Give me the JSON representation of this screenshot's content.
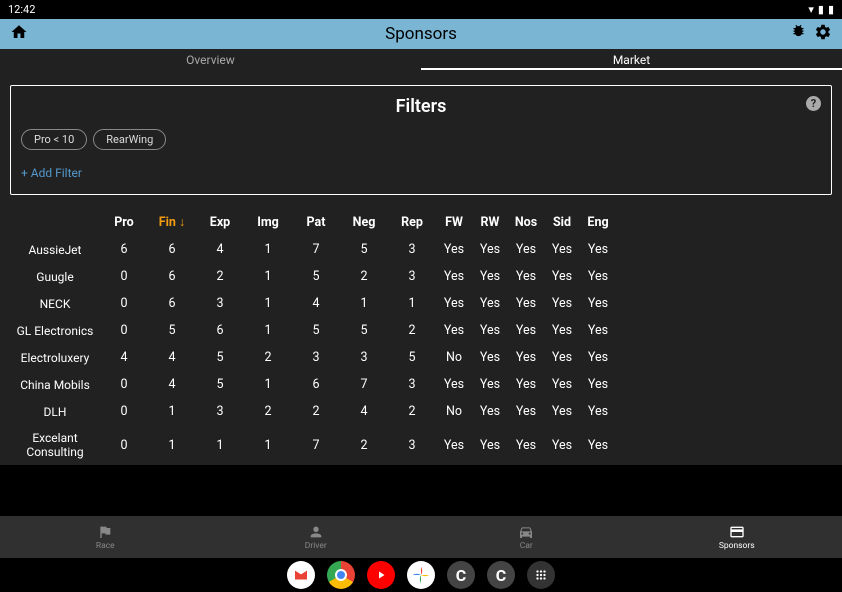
{
  "status": {
    "time": "12:42"
  },
  "header": {
    "title": "Sponsors"
  },
  "tabs": {
    "overview": "Overview",
    "market": "Market"
  },
  "filters": {
    "title": "Filters",
    "chips": [
      "Pro < 10",
      "RearWing"
    ],
    "add": "+ Add Filter"
  },
  "columns": [
    "Pro",
    "Fin",
    "Exp",
    "Img",
    "Pat",
    "Neg",
    "Rep",
    "FW",
    "RW",
    "Nos",
    "Sid",
    "Eng"
  ],
  "sort_col": "Fin",
  "rows": [
    {
      "name": "AussieJet",
      "nums": [
        6,
        6,
        4,
        1,
        7,
        5,
        3
      ],
      "bools": [
        "Yes",
        "Yes",
        "Yes",
        "Yes",
        "Yes"
      ]
    },
    {
      "name": "Guugle",
      "nums": [
        0,
        6,
        2,
        1,
        5,
        2,
        3
      ],
      "bools": [
        "Yes",
        "Yes",
        "Yes",
        "Yes",
        "Yes"
      ]
    },
    {
      "name": "NECK",
      "nums": [
        0,
        6,
        3,
        1,
        4,
        1,
        1
      ],
      "bools": [
        "Yes",
        "Yes",
        "Yes",
        "Yes",
        "Yes"
      ]
    },
    {
      "name": "GL Electronics",
      "nums": [
        0,
        5,
        6,
        1,
        5,
        5,
        2
      ],
      "bools": [
        "Yes",
        "Yes",
        "Yes",
        "Yes",
        "Yes"
      ]
    },
    {
      "name": "Electroluxery",
      "nums": [
        4,
        4,
        5,
        2,
        3,
        3,
        5
      ],
      "bools": [
        "No",
        "Yes",
        "Yes",
        "Yes",
        "Yes"
      ]
    },
    {
      "name": "China Mobils",
      "nums": [
        0,
        4,
        5,
        1,
        6,
        7,
        3
      ],
      "bools": [
        "Yes",
        "Yes",
        "Yes",
        "Yes",
        "Yes"
      ]
    },
    {
      "name": "DLH",
      "nums": [
        0,
        1,
        3,
        2,
        2,
        4,
        2
      ],
      "bools": [
        "No",
        "Yes",
        "Yes",
        "Yes",
        "Yes"
      ]
    },
    {
      "name": "Excelant Consulting",
      "nums": [
        0,
        1,
        1,
        1,
        7,
        2,
        3
      ],
      "bools": [
        "Yes",
        "Yes",
        "Yes",
        "Yes",
        "Yes"
      ]
    }
  ],
  "nav": {
    "race": "Race",
    "driver": "Driver",
    "car": "Car",
    "sponsors": "Sponsors"
  }
}
